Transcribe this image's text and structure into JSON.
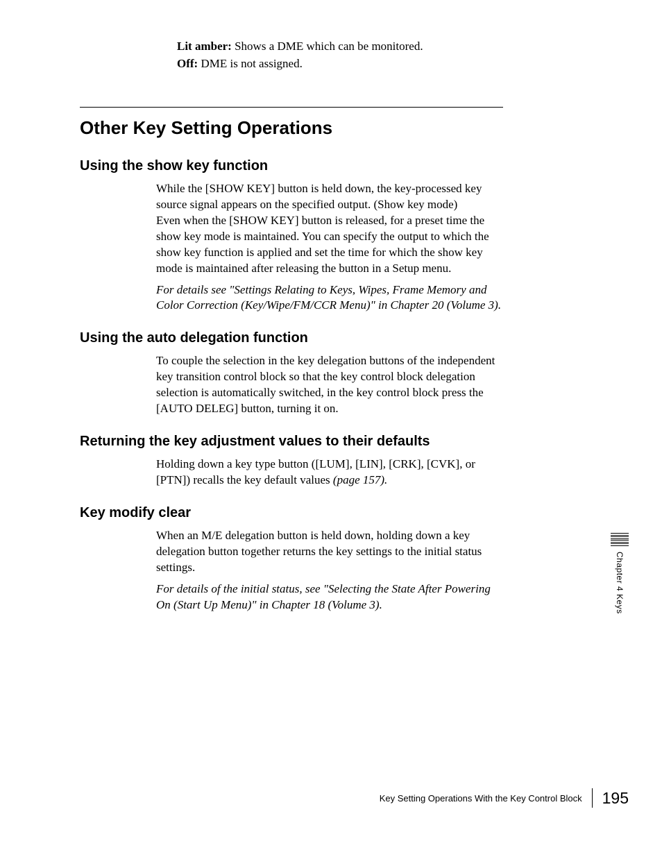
{
  "intro": {
    "items": [
      {
        "label": "Lit amber:",
        "text": " Shows a DME which can be monitored."
      },
      {
        "label": "Off:",
        "text": " DME is not assigned."
      }
    ]
  },
  "section": {
    "title": "Other Key Setting Operations",
    "subsections": [
      {
        "title": "Using the show key function",
        "paragraphs": [
          "While the [SHOW KEY] button is held down, the key-processed key source signal appears on the specified output. (Show key mode)\nEven when the [SHOW KEY] button is released, for a preset time the show key mode is maintained. You can specify the output to which the show key function is applied and set the time for which the show key mode is maintained after releasing the button in a Setup menu."
        ],
        "reference": "For details see \"Settings Relating to Keys, Wipes, Frame Memory and Color Correction (Key/Wipe/FM/CCR Menu)\" in Chapter 20 (Volume 3)."
      },
      {
        "title": "Using the auto delegation function",
        "paragraphs": [
          "To couple the selection in the key delegation buttons of the independent key transition control block so that the key control block delegation selection is automatically switched, in the key control block press the [AUTO DELEG] button, turning it on."
        ]
      },
      {
        "title": "Returning the key adjustment values to their defaults",
        "paragraphs_mixed": {
          "prefix": "Holding down a key type button ([LUM], [LIN], [CRK], [CVK], or [PTN]) recalls the key default values ",
          "page_ref": "(page 157).",
          "suffix": ""
        }
      },
      {
        "title": "Key modify clear",
        "paragraphs": [
          "When an M/E delegation button is held down, holding down a key delegation button together returns the key settings to the initial status settings."
        ],
        "reference": "For details of the initial status, see \"Selecting the State After Powering On (Start Up Menu)\" in Chapter 18 (Volume 3)."
      }
    ]
  },
  "side_tab": "Chapter 4  Keys",
  "footer": {
    "text": "Key Setting Operations With the Key Control Block",
    "page": "195"
  }
}
